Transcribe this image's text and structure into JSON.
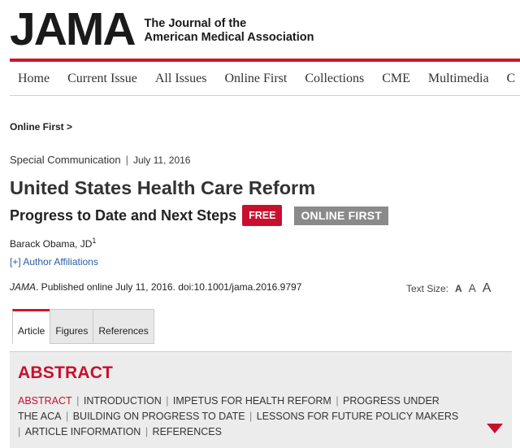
{
  "masthead": {
    "logo": "JAMA",
    "subtitle_line1": "The Journal of the",
    "subtitle_line2": "American Medical Association"
  },
  "colors": {
    "brand_red": "#c8102e",
    "badge_gray": "#8a8a8a",
    "link_blue": "#2a5ea8"
  },
  "nav": {
    "items": [
      {
        "label": "Home"
      },
      {
        "label": "Current Issue"
      },
      {
        "label": "All Issues"
      },
      {
        "label": "Online First"
      },
      {
        "label": "Collections"
      },
      {
        "label": "CME"
      },
      {
        "label": "Multimedia"
      },
      {
        "label": "C"
      }
    ]
  },
  "breadcrumb": {
    "label": "Online First >"
  },
  "article": {
    "type": "Special Communication",
    "separator": "|",
    "date": "July 11, 2016",
    "title": "United States Health Care Reform",
    "subtitle": "Progress to Date and Next Steps",
    "badge_free": "FREE",
    "badge_online": "ONLINE FIRST",
    "author": "Barack Obama, JD",
    "author_sup": "1",
    "affiliations_link": "[+] Author Affiliations",
    "citation_journal": "JAMA",
    "citation_rest": ". Published online July 11, 2016. doi:10.1001/jama.2016.9797"
  },
  "text_size": {
    "label": "Text Size:",
    "small": "A",
    "medium": "A",
    "large": "A"
  },
  "tabs": [
    {
      "label": "Article",
      "active": true
    },
    {
      "label": "Figures",
      "active": false
    },
    {
      "label": "References",
      "active": false
    }
  ],
  "abstract": {
    "heading": "ABSTRACT",
    "sections": [
      {
        "label": "ABSTRACT",
        "active": true
      },
      {
        "label": "INTRODUCTION",
        "active": false
      },
      {
        "label": "IMPETUS FOR HEALTH REFORM",
        "active": false
      },
      {
        "label": "PROGRESS UNDER THE ACA",
        "active": false
      },
      {
        "label": "BUILDING ON PROGRESS TO DATE",
        "active": false
      },
      {
        "label": "LESSONS FOR FUTURE POLICY MAKERS",
        "active": false
      },
      {
        "label": "ARTICLE INFORMATION",
        "active": false
      },
      {
        "label": "REFERENCES",
        "active": false
      }
    ],
    "expand_icon": "triangle-down-icon"
  }
}
